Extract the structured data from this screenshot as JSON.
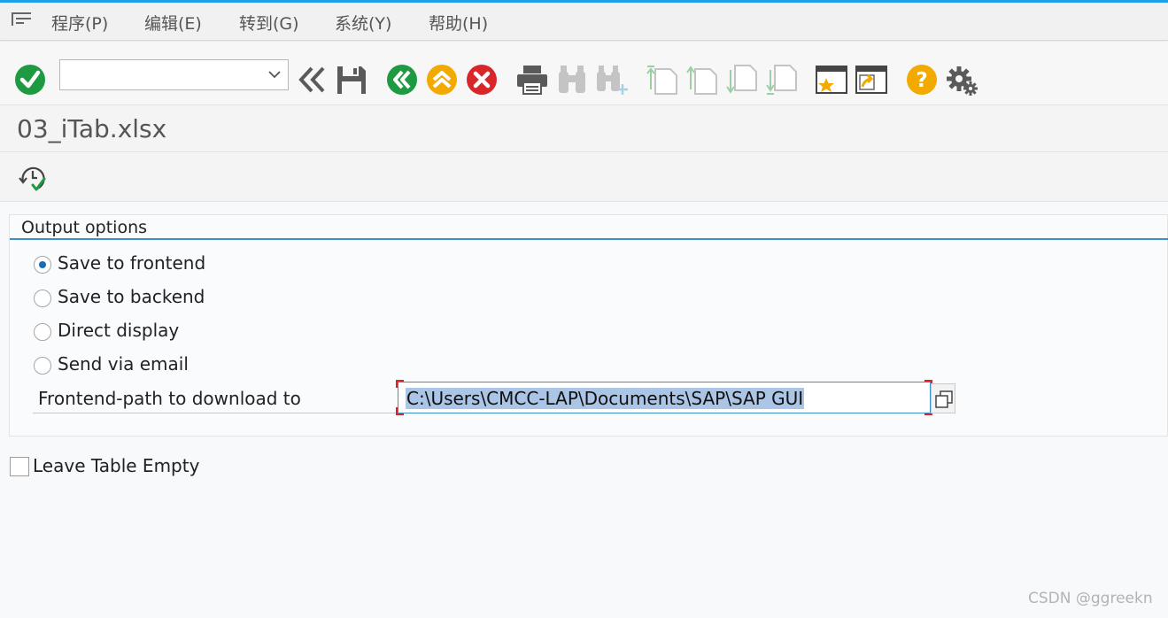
{
  "menu": {
    "items": [
      "程序(P)",
      "编辑(E)",
      "转到(G)",
      "系统(Y)",
      "帮助(H)"
    ]
  },
  "toolbar": {
    "command_field_value": "",
    "icons": [
      "enter-icon",
      "command-dropdown-icon",
      "collapse-icon",
      "save-icon",
      "back-icon",
      "exit-icon",
      "cancel-icon",
      "print-icon",
      "find-icon",
      "find-next-icon",
      "first-page-icon",
      "previous-page-icon",
      "next-page-icon",
      "last-page-icon",
      "create-session-icon",
      "shortcut-icon",
      "help-icon",
      "customize-layout-icon"
    ]
  },
  "title": "03_iTab.xlsx",
  "app_toolbar": {
    "icons": [
      "execute-icon"
    ]
  },
  "output_options": {
    "title": "Output options",
    "radios": [
      {
        "label": "Save to frontend",
        "checked": true
      },
      {
        "label": "Save to backend",
        "checked": false
      },
      {
        "label": "Direct display",
        "checked": false
      },
      {
        "label": "Send via email",
        "checked": false
      }
    ],
    "path_label": "Frontend-path to download to",
    "path_value": "C:\\Users\\CMCC-LAP\\Documents\\SAP\\SAP GUI"
  },
  "leave_table_empty": {
    "label": "Leave Table Empty",
    "checked": false
  },
  "watermark": "CSDN @ggreekn",
  "colors": {
    "accent": "#1ea1e8",
    "enter_green": "#1e9a43",
    "back_green": "#1e9a43",
    "exit_orange": "#f2a900",
    "cancel_red": "#d9262b",
    "help_orange": "#f2a900",
    "disabled_gray": "#c4c4c4",
    "selection": "#aac5e5"
  }
}
